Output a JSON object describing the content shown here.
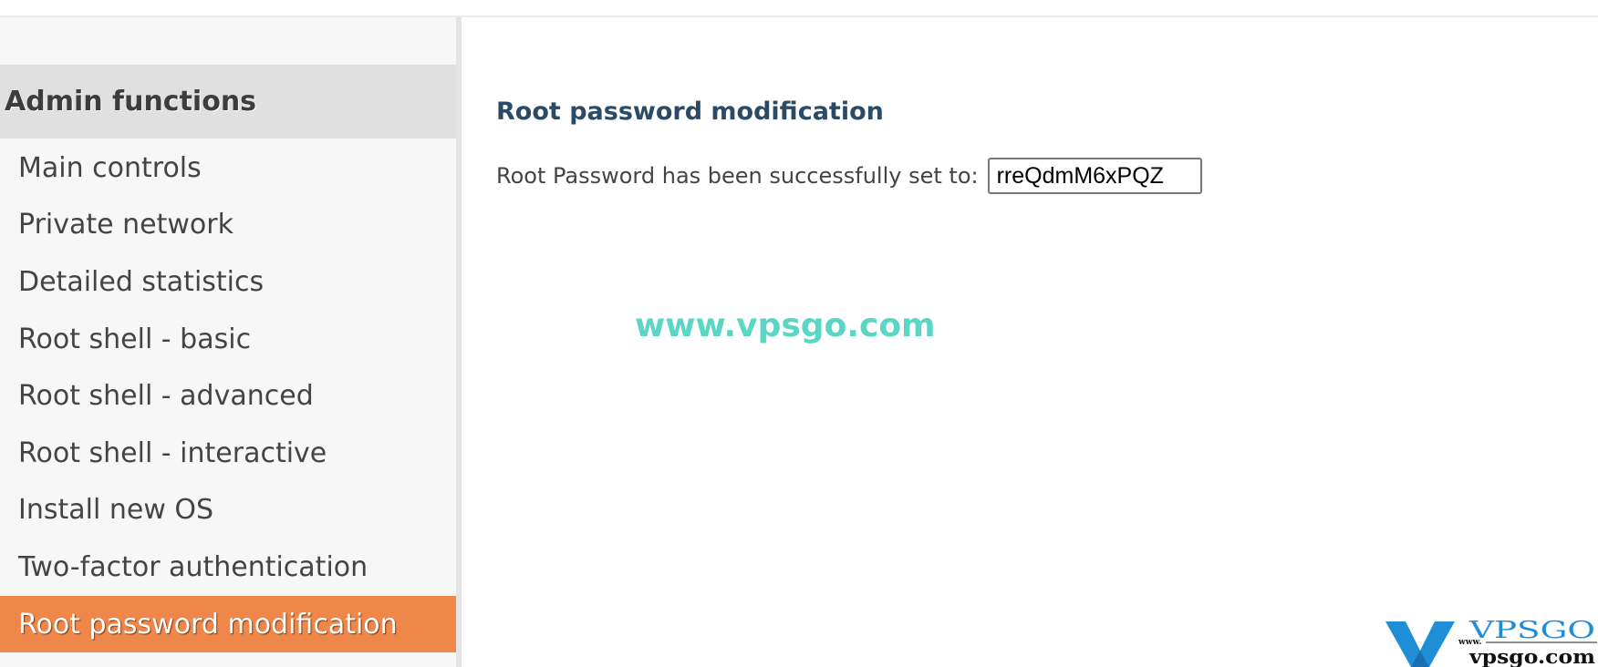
{
  "sidebar": {
    "header": "Admin functions",
    "items": [
      {
        "label": "Main controls"
      },
      {
        "label": "Private network"
      },
      {
        "label": "Detailed statistics"
      },
      {
        "label": "Root shell - basic"
      },
      {
        "label": "Root shell - advanced"
      },
      {
        "label": "Root shell - interactive"
      },
      {
        "label": "Install new OS"
      },
      {
        "label": "Two-factor authentication"
      },
      {
        "label": "Root password modification",
        "active": true
      }
    ],
    "active_color": "#f0874a"
  },
  "main": {
    "title": "Root password modification",
    "message": "Root Password has been successfully set to:",
    "password_value": "rreQdmM6xPQZ"
  },
  "watermark": {
    "text": "www.vpsgo.com",
    "logo_text": "VPSGO www.vpsgo.com"
  }
}
